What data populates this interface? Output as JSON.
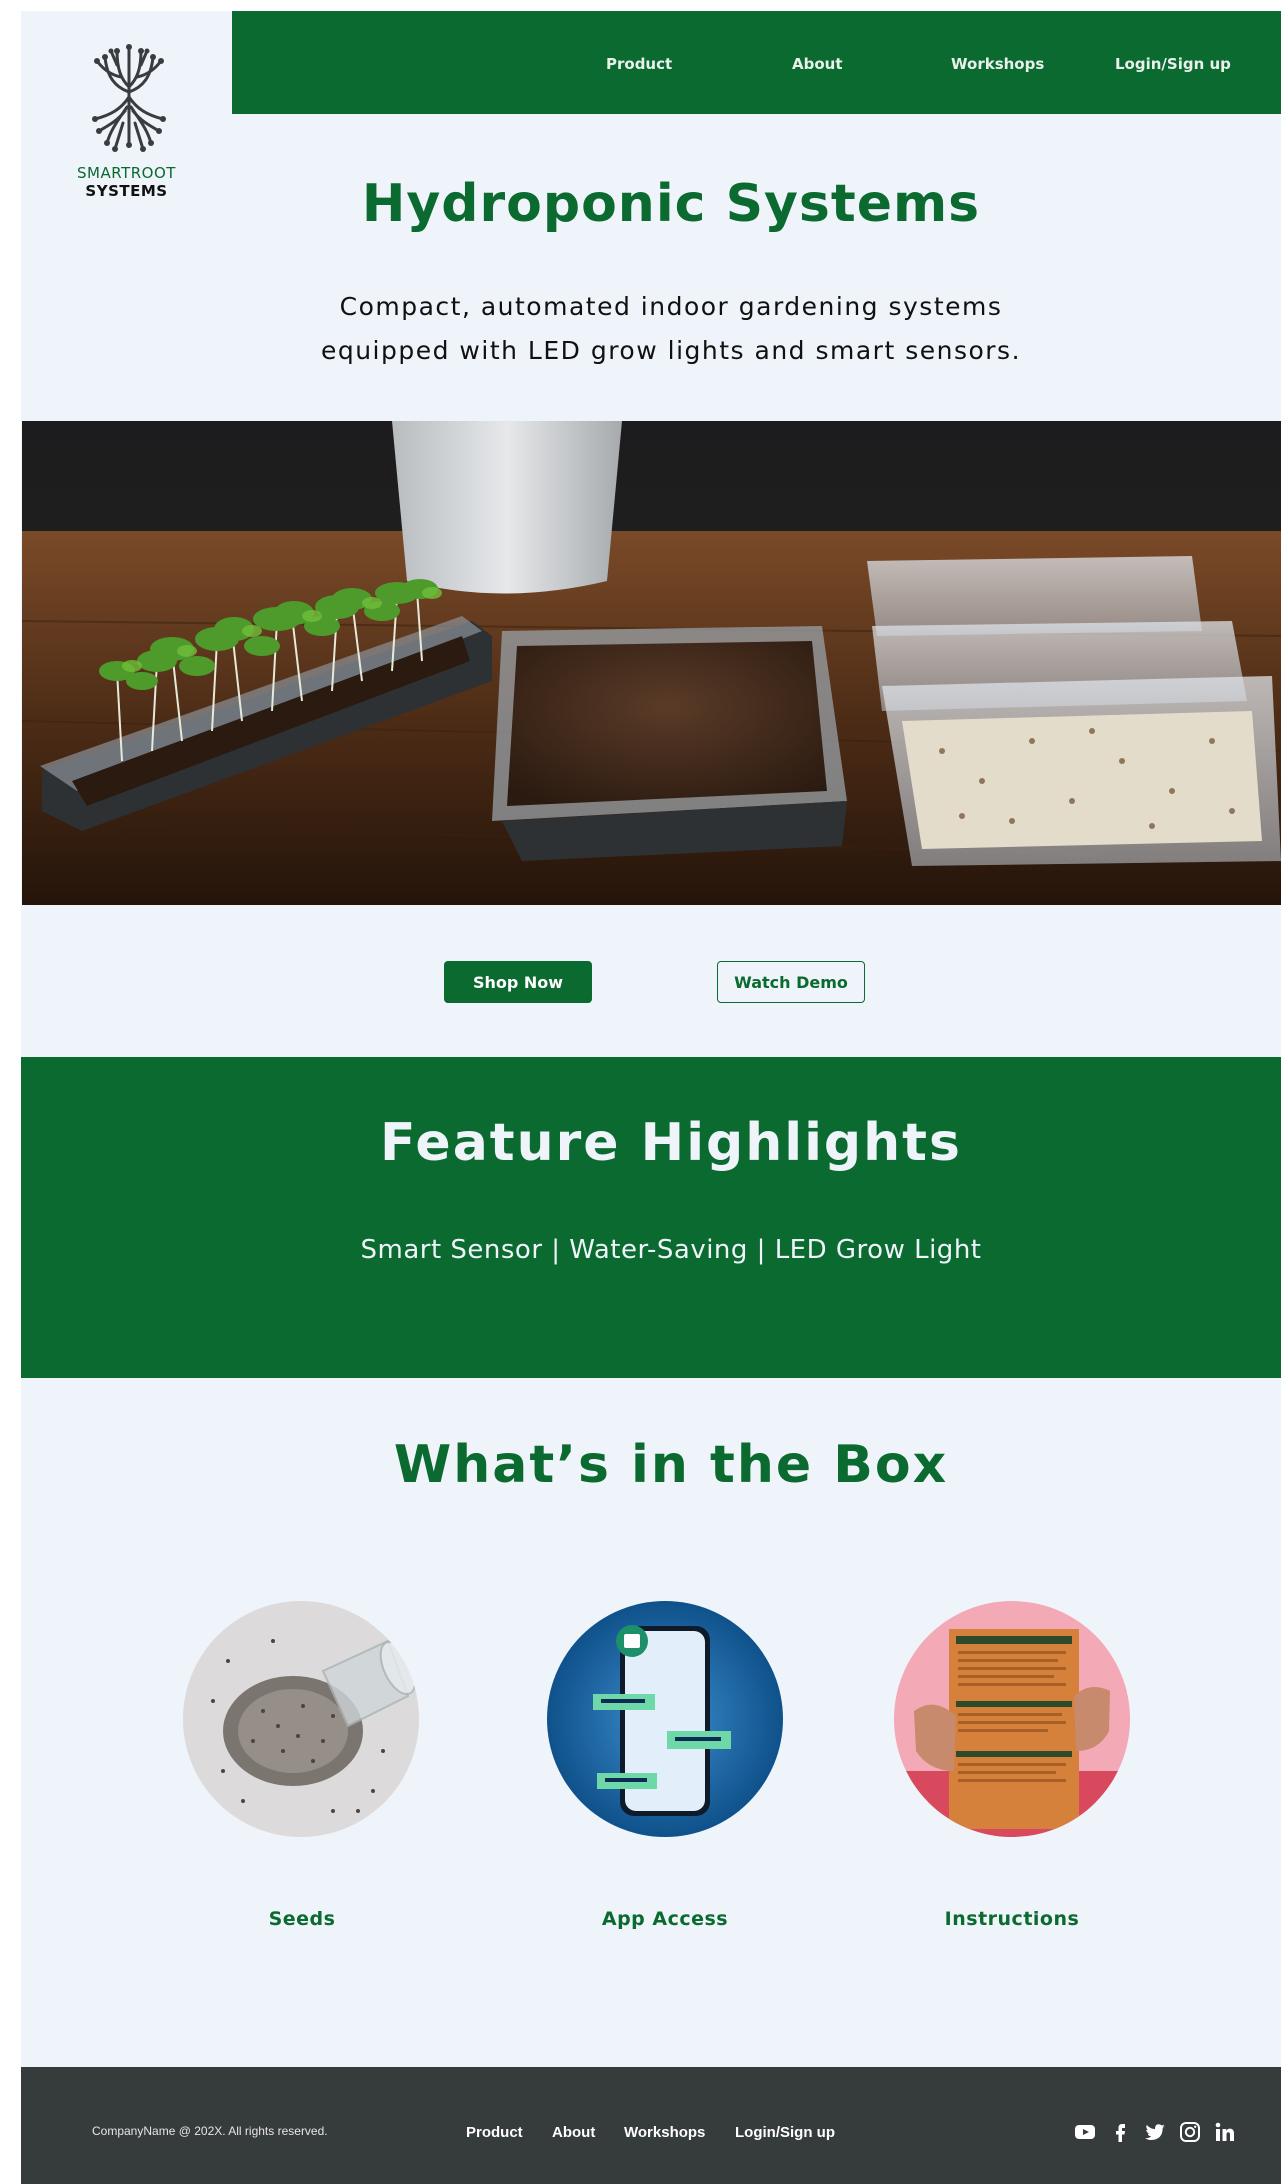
{
  "brand": {
    "line1": "SMARTROOT",
    "line2": "SYSTEMS"
  },
  "nav": {
    "items": [
      "Product",
      "About",
      "Workshops",
      "Login/Sign up"
    ]
  },
  "hero": {
    "title": "Hydroponic Systems",
    "subtitle_line1": "Compact, automated indoor gardening systems",
    "subtitle_line2": "equipped with LED grow lights and smart sensors."
  },
  "actions": {
    "primary": "Shop Now",
    "secondary": "Watch Demo"
  },
  "features": {
    "title": "Feature Highlights",
    "subtitle": "Smart Sensor | Water-Saving | LED Grow Light"
  },
  "box": {
    "title": "What’s in the Box",
    "items": [
      {
        "label": "Seeds",
        "icon": "seeds-image"
      },
      {
        "label": "App Access",
        "icon": "phone-app-image"
      },
      {
        "label": "Instructions",
        "icon": "instructions-booklet-image"
      }
    ]
  },
  "footer": {
    "copyright": "CompanyName @ 202X. All rights reserved.",
    "links": [
      "Product",
      "About",
      "Workshops",
      "Login/Sign up"
    ],
    "social": [
      "youtube-icon",
      "facebook-icon",
      "twitter-icon",
      "instagram-icon",
      "linkedin-icon"
    ]
  },
  "colors": {
    "brand_green": "#0a6a2f",
    "page_bg": "#eef4f9",
    "footer_bg": "#363b3b"
  }
}
